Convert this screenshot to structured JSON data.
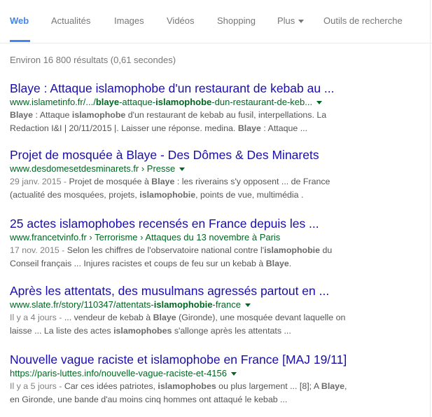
{
  "tabs": [
    {
      "label": "Web",
      "active": true
    },
    {
      "label": "Actualités",
      "active": false
    },
    {
      "label": "Images",
      "active": false
    },
    {
      "label": "Vidéos",
      "active": false
    },
    {
      "label": "Shopping",
      "active": false
    },
    {
      "label": "Plus",
      "active": false
    },
    {
      "label": "Outils de recherche",
      "active": false
    }
  ],
  "stats": "Environ 16 800 résultats (0,61 secondes)",
  "results": [
    {
      "title": "Blaye : Attaque islamophobe d'un restaurant de kebab au ...",
      "url_parts": [
        "www.islametinfo.fr/.../",
        "blaye",
        "-attaque-",
        "islamophobe",
        "-dun-restaurant-de-keb..."
      ],
      "snippet_parts": [
        "Blaye",
        " : Attaque ",
        "islamophobe",
        " d'un restaurant de kebab au fusil, interpellations. La Redaction I&I | 20/11/2015 |. Laisser une réponse. medina. ",
        "Blaye",
        " : Attaque ..."
      ]
    },
    {
      "title": "Projet de mosquée à Blaye - Des Dômes & Des Minarets",
      "url": "www.desdomesetdesminarets.fr › Presse",
      "date": "29 janv. 2015 - ",
      "snippet_parts": [
        "Projet de mosquée à ",
        "Blaye",
        " : les riverains s'y opposent ... de France (actualité des mosquées, projets, ",
        "islamophobie",
        ", points de vue, multimédia ."
      ]
    },
    {
      "title": "25 actes islamophobes recensés en France depuis les ...",
      "url": "www.francetvinfo.fr › Terrorisme › Attaques du 13 novembre à Paris",
      "date": "17 nov. 2015 - ",
      "snippet_parts": [
        "Selon les chiffres de l'observatoire national contre l'",
        "islamophobie",
        " du Conseil français ... Injures racistes et coups de feu sur un kebab à ",
        "Blaye",
        "."
      ]
    },
    {
      "title": "Après les attentats, des musulmans agressés partout en ...",
      "url_parts": [
        "www.slate.fr/story/110347/attentats-",
        "islamophobie",
        "-france"
      ],
      "date": "Il y a 4 jours - ",
      "snippet_parts": [
        "... vendeur de kebab à ",
        "Blaye",
        " (Gironde), une mosquée devant laquelle on laisse ... La liste des actes ",
        "islamophobes",
        " s'allonge après les attentats  ..."
      ]
    },
    {
      "title": "Nouvelle vague raciste et islamophobe en France [MAJ 19/11]",
      "url": "https://paris-luttes.info/nouvelle-vague-raciste-et-4156",
      "date": "Il y a 5 jours - ",
      "snippet_parts": [
        "Car ces idées patriotes, ",
        "islamophobes",
        " ou plus largement ... [8]; A ",
        "Blaye",
        ", en Gironde, une bande d'au moins cinq hommes ont attaqué le kebab  ..."
      ]
    }
  ]
}
